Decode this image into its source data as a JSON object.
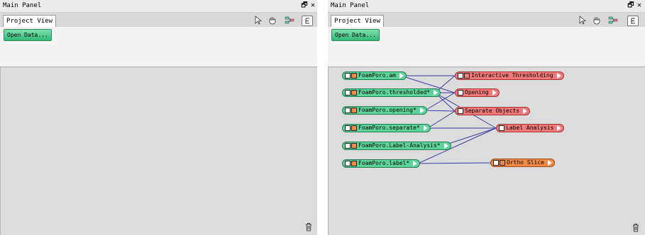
{
  "left_panel": {
    "title": "Main Panel",
    "tab": "Project View",
    "open_data_label": "Open Data...",
    "restore_glyph": "🗗",
    "close_glyph": "✕"
  },
  "right_panel": {
    "title": "Main Panel",
    "tab": "Project View",
    "open_data_label": "Open Data...",
    "restore_glyph": "🗗",
    "close_glyph": "✕",
    "nodes": {
      "foam_am": "FoamPoro.am",
      "foam_thresholded": "FoamPoro.thresholded*",
      "foam_opening": "FoamPoro.opening*",
      "foam_separate": "FoamPoro.separate*",
      "foam_label_analysis": "FoamPoro.Label-Analysis*",
      "foam_label": "FoamPoro.label*",
      "interactive_thresholding": "Interactive Thresholding",
      "opening": "Opening",
      "separate_objects": "Separate Objects",
      "label_analysis": "Label Analysis",
      "ortho_slice": "Ortho Slice"
    }
  },
  "icons": [
    "pointer-icon",
    "hand-icon",
    "network-icon",
    "e-icon",
    "trash-icon",
    "restore-icon",
    "close-icon"
  ],
  "colors": {
    "data_node": "#5fd39c",
    "module_node": "#f07a7a",
    "ortho_node": "#f08a44",
    "connection": "#3a3aa8",
    "open_button": "#32b877"
  }
}
